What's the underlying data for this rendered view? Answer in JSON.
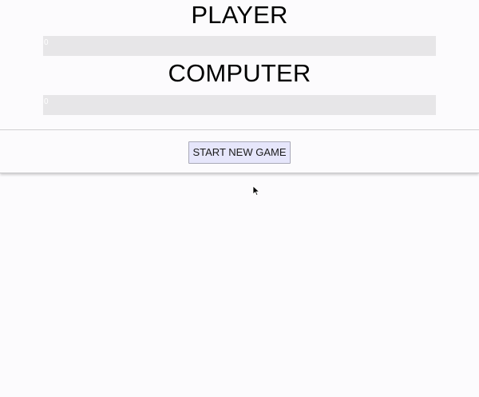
{
  "player": {
    "title": "PLAYER",
    "score": "0"
  },
  "computer": {
    "title": "COMPUTER",
    "score": "0"
  },
  "controls": {
    "start_label": "START NEW GAME"
  },
  "colors": {
    "background": "#fcfbfd",
    "score_bar": "#e7e6e8",
    "button_bg": "#e6e6fb"
  },
  "icons": {
    "pointer": "mouse-pointer-icon"
  }
}
